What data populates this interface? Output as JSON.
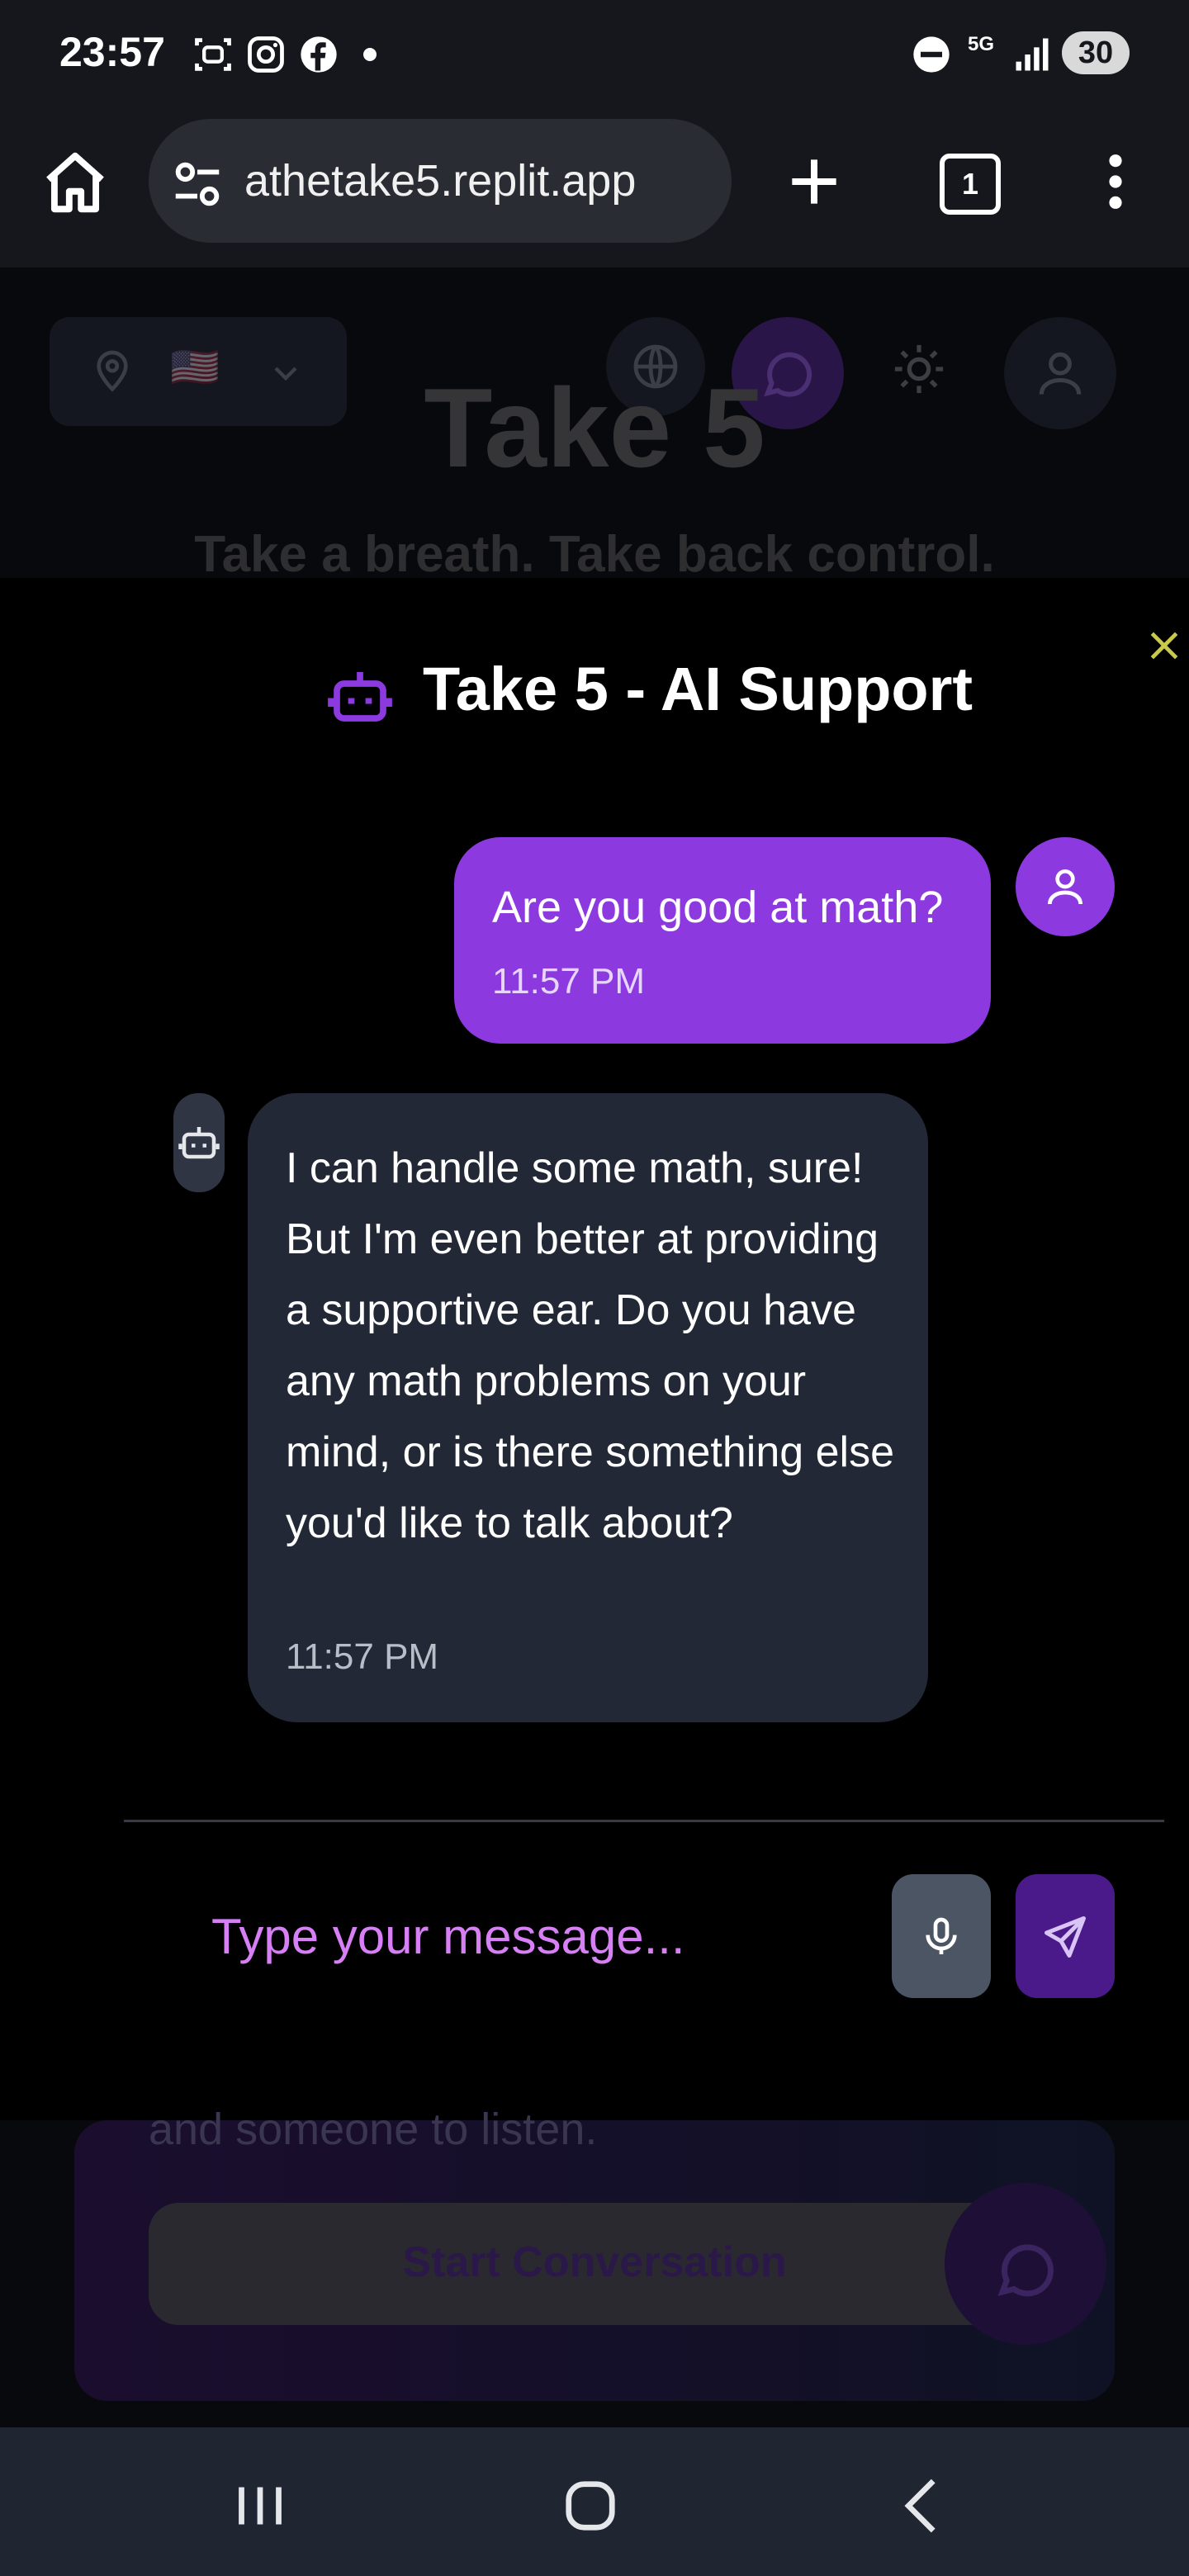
{
  "statusbar": {
    "time": "23:57",
    "signal_label": "5G",
    "battery": "30"
  },
  "browser": {
    "url": "athetake5.replit.app",
    "tab_count": "1"
  },
  "background": {
    "title": "Take 5",
    "subtitle": "Take a breath. Take back control.",
    "card_text": "and someone to listen.",
    "start_button": "Start Conversation",
    "flag": "🇺🇸"
  },
  "chat": {
    "title": "Take 5 - AI Support",
    "messages": [
      {
        "role": "user",
        "text": "Are you good at math?",
        "time": "11:57 PM"
      },
      {
        "role": "bot",
        "text": "I can handle some math, sure! But I'm even better at providing a supportive ear. Do you have any math problems on your mind, or is there something else you'd like to talk about?",
        "time": "11:57 PM"
      }
    ],
    "input_placeholder": "Type your message..."
  },
  "colors": {
    "accent": "#8c3ae0",
    "close_icon": "#c9c94a",
    "placeholder": "#d77ff5",
    "bot_bubble": "#222835"
  }
}
